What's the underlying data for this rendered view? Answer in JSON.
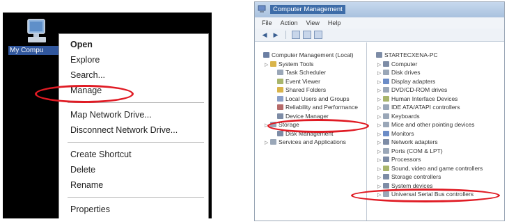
{
  "desktop": {
    "icon_label": "My Compu",
    "icon": "computer-icon"
  },
  "context_menu": {
    "groups": [
      [
        {
          "label": "Open",
          "bold": true
        },
        {
          "label": "Explore"
        },
        {
          "label": "Search..."
        },
        {
          "label": "Manage",
          "highlighted": true
        }
      ],
      [
        {
          "label": "Map Network Drive..."
        },
        {
          "label": "Disconnect Network Drive..."
        }
      ],
      [
        {
          "label": "Create Shortcut"
        },
        {
          "label": "Delete"
        },
        {
          "label": "Rename"
        }
      ],
      [
        {
          "label": "Properties"
        }
      ]
    ],
    "highlight_color": "#e01b24"
  },
  "window": {
    "title": "Computer Management",
    "menu": [
      "File",
      "Action",
      "View",
      "Help"
    ],
    "toolbar_icons": [
      "back-arrow-icon",
      "forward-arrow-icon",
      "folder-icon",
      "properties-icon",
      "help-icon"
    ],
    "left_tree": [
      {
        "label": "Computer Management (Local)",
        "level": 0,
        "color": "#6b7fa3"
      },
      {
        "label": "System Tools",
        "level": 1,
        "color": "#d9b44a"
      },
      {
        "label": "Task Scheduler",
        "level": 2,
        "color": "#9aa7b8"
      },
      {
        "label": "Event Viewer",
        "level": 2,
        "color": "#a8b56c"
      },
      {
        "label": "Shared Folders",
        "level": 2,
        "color": "#d9b44a"
      },
      {
        "label": "Local Users and Groups",
        "level": 2,
        "color": "#8a9fc8"
      },
      {
        "label": "Reliability and Performance",
        "level": 2,
        "color": "#b66a6a"
      },
      {
        "label": "Device Manager",
        "level": 2,
        "color": "#7d8ca6",
        "highlighted": true
      },
      {
        "label": "Storage",
        "level": 1,
        "color": "#9aa7b8"
      },
      {
        "label": "Disk Management",
        "level": 2,
        "color": "#7d8ca6"
      },
      {
        "label": "Services and Applications",
        "level": 1,
        "color": "#9aa7b8"
      }
    ],
    "right_tree": [
      {
        "label": "STARTECXENA-PC",
        "level": 0,
        "color": "#7d8ca6"
      },
      {
        "label": "Computer",
        "level": 1,
        "color": "#7d8ca6"
      },
      {
        "label": "Disk drives",
        "level": 1,
        "color": "#9aa7b8"
      },
      {
        "label": "Display adapters",
        "level": 1,
        "color": "#6b8cc7"
      },
      {
        "label": "DVD/CD-ROM drives",
        "level": 1,
        "color": "#9aa7b8"
      },
      {
        "label": "Human Interface Devices",
        "level": 1,
        "color": "#a8b56c"
      },
      {
        "label": "IDE ATA/ATAPI controllers",
        "level": 1,
        "color": "#9aa7b8"
      },
      {
        "label": "Keyboards",
        "level": 1,
        "color": "#9aa7b8"
      },
      {
        "label": "Mice and other pointing devices",
        "level": 1,
        "color": "#9aa7b8"
      },
      {
        "label": "Monitors",
        "level": 1,
        "color": "#6b8cc7"
      },
      {
        "label": "Network adapters",
        "level": 1,
        "color": "#7d8ca6"
      },
      {
        "label": "Ports (COM & LPT)",
        "level": 1,
        "color": "#9aa7b8"
      },
      {
        "label": "Processors",
        "level": 1,
        "color": "#7d8ca6"
      },
      {
        "label": "Sound, video and game controllers",
        "level": 1,
        "color": "#a8b56c"
      },
      {
        "label": "Storage controllers",
        "level": 1,
        "color": "#7d8ca6",
        "highlighted": true
      },
      {
        "label": "System devices",
        "level": 1,
        "color": "#7d8ca6"
      },
      {
        "label": "Universal Serial Bus controllers",
        "level": 1,
        "color": "#9aa7b8"
      }
    ]
  }
}
